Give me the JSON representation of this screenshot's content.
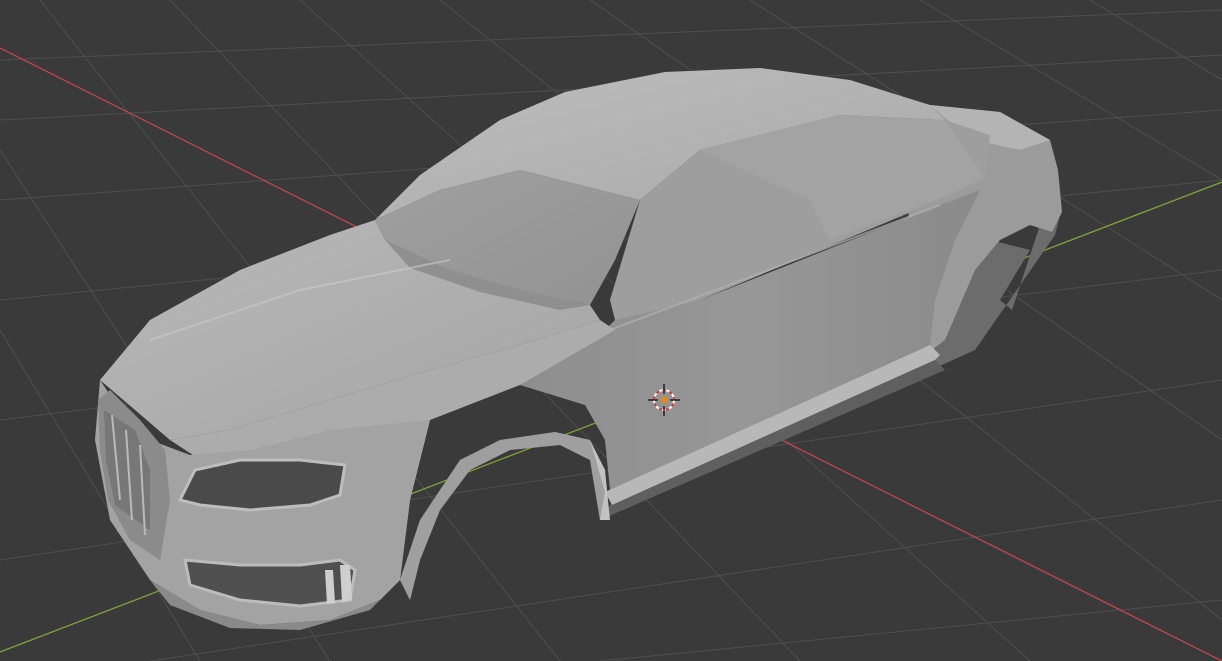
{
  "viewport": {
    "mode": "3d-viewport",
    "shading": "solid",
    "background_color": "#3a3a3a",
    "grid_color": "#4f4f4f",
    "x_axis_color": "#c0464f",
    "y_axis_color": "#7ea43a"
  },
  "object": {
    "type": "mesh",
    "description_icon": "car-body-mesh",
    "color": "#a9a9a9"
  },
  "cursor": {
    "icon": "3d-cursor-icon"
  }
}
